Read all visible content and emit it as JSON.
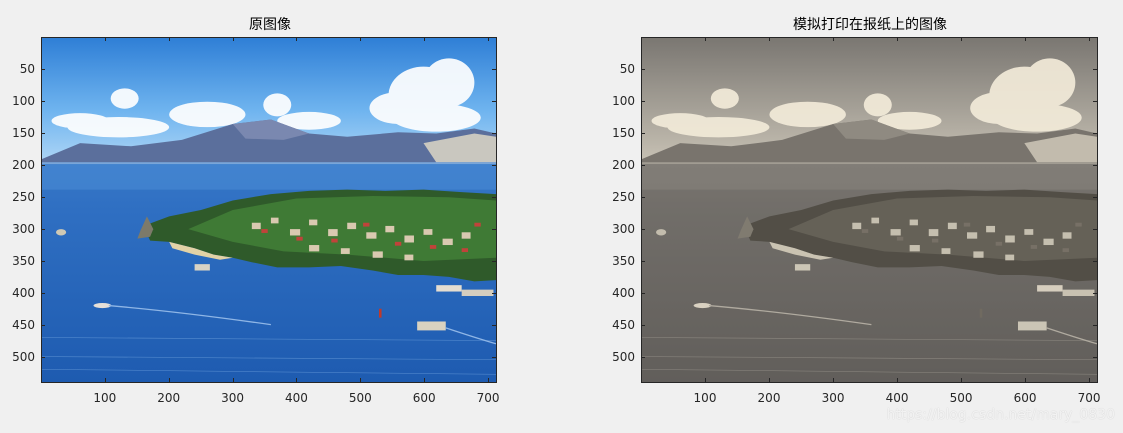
{
  "figure": {
    "axes": [
      {
        "title": "原图像",
        "filter": "original",
        "x_ticks": [
          "100",
          "200",
          "300",
          "400",
          "500",
          "600",
          "700"
        ],
        "y_ticks": [
          "50",
          "100",
          "150",
          "200",
          "250",
          "300",
          "350",
          "400",
          "450",
          "500"
        ]
      },
      {
        "title": "模拟打印在报纸上的图像",
        "filter": "newspaper",
        "x_ticks": [
          "100",
          "200",
          "300",
          "400",
          "500",
          "600",
          "700"
        ],
        "y_ticks": [
          "50",
          "100",
          "150",
          "200",
          "250",
          "300",
          "350",
          "400",
          "450",
          "500"
        ]
      }
    ],
    "image_xlim": [
      0,
      714
    ],
    "image_ylim": [
      0,
      540
    ]
  },
  "watermark": "https://blog.csdn.net/mary_0830"
}
